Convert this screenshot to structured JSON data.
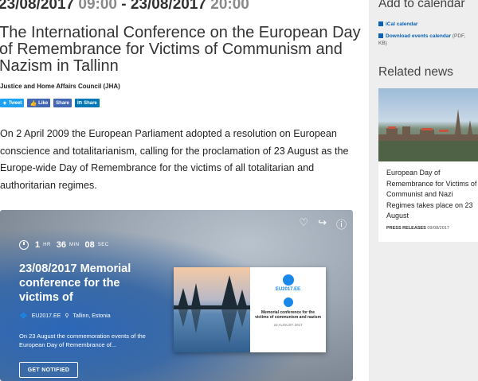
{
  "event": {
    "start_date": "23/08/2017",
    "start_time": "09:00",
    "separator": "-",
    "end_date": "23/08/2017",
    "end_time": "20:00",
    "title": "The International Conference on the European Day of Remembrance for Victims of Communism and Nazism in Tallinn",
    "council": "Justice and Home Affairs Council (JHA)",
    "body": "On 2 April 2009 the European Parliament adopted a resolution on European conscience and totalitarianism, calling for the proclamation of 23 August as the Europe-wide Day of Remembrance for the victims of all totalitarian and authoritarian regimes."
  },
  "share": {
    "tweet": "Tweet",
    "like": "Like",
    "share": "Share",
    "linkedin_share": "Share",
    "colors": {
      "twitter": "#1da1f2",
      "facebook": "#4267b2",
      "linkedin": "#0077b5"
    }
  },
  "embed": {
    "countdown": {
      "hours": "1",
      "hours_unit": "HR",
      "minutes": "36",
      "minutes_unit": "MIN",
      "seconds": "08",
      "seconds_unit": "SEC"
    },
    "title": "23/08/2017 Memorial conference for the victims of",
    "organizer": "EU2017.EE",
    "location": "Tallinn, Estonia",
    "description": "On 23 August the commemoration events of the European Day of Remembrance of...",
    "button": "GET NOTIFIED",
    "icons": [
      "heart-icon",
      "share-icon",
      "info-icon"
    ],
    "poster": {
      "brand": "EU2017.EE",
      "title": "Memorial conference for the victims of communism and nazism",
      "date": "23 AUGUST 2017"
    }
  },
  "sidebar": {
    "add_to_calendar": "Add to calendar",
    "ical": "iCal calendar",
    "download": "Download events calendar",
    "download_note": "(PDF,",
    "download_size": "KB)",
    "related_news": "Related news",
    "news": {
      "title": "European Day of Remembrance for Victims of Communist and Nazi Regimes takes place on 23 August",
      "category": "PRESS RELEASES",
      "date": "09/08/2017"
    }
  }
}
